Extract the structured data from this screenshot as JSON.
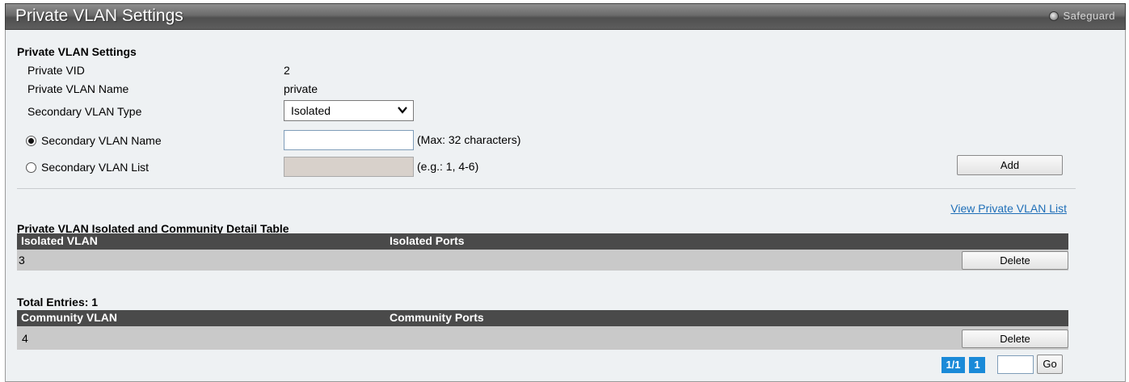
{
  "header": {
    "title": "Private VLAN Settings",
    "safeguard_label": "Safeguard"
  },
  "settings": {
    "section_title": "Private VLAN Settings",
    "private_vid_label": "Private VID",
    "private_vid_value": "2",
    "private_vlan_name_label": "Private VLAN Name",
    "private_vlan_name_value": "private",
    "secondary_type_label": "Secondary VLAN Type",
    "secondary_type_value": "Isolated",
    "secondary_name_label": "Secondary VLAN Name",
    "secondary_name_value": "",
    "secondary_name_hint": "(Max: 32 characters)",
    "secondary_list_label": "Secondary VLAN List",
    "secondary_list_value": "",
    "secondary_list_hint": "(e.g.: 1, 4-6)",
    "selected_option": "secondary_vlan_name",
    "add_label": "Add"
  },
  "view_list_link": "View Private VLAN List",
  "isolated_table": {
    "title": "Private VLAN Isolated and Community Detail Table",
    "columns": [
      "Isolated VLAN",
      "Isolated Ports"
    ],
    "rows": [
      {
        "vlan": "3",
        "ports": "",
        "action": "Delete"
      }
    ]
  },
  "total_entries": "Total Entries: 1",
  "community_table": {
    "columns": [
      "Community VLAN",
      "Community Ports"
    ],
    "rows": [
      {
        "vlan": "4",
        "ports": "",
        "action": "Delete"
      }
    ]
  },
  "pagination": {
    "page_info": "1/1",
    "current_page": "1",
    "page_input": "",
    "go_label": "Go"
  },
  "colors": {
    "link": "#1f6fb8",
    "pager": "#1a8ad8",
    "table_header": "#4a4a4a",
    "table_row": "#c9c9c9"
  }
}
